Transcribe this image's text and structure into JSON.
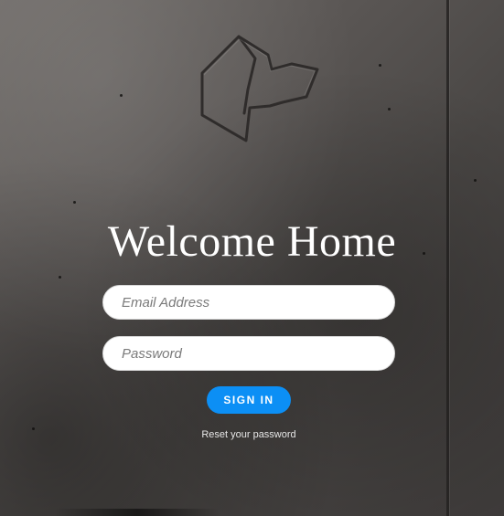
{
  "welcome": {
    "title": "Welcome Home"
  },
  "form": {
    "email_placeholder": "Email Address",
    "password_placeholder": "Password",
    "submit_label": "SIGN IN",
    "reset_link": "Reset your password"
  },
  "colors": {
    "accent": "#0c8ff5",
    "title_text": "#ffffff",
    "field_bg": "#ffffff"
  },
  "icons": {
    "logo": "dog-head-icon"
  }
}
